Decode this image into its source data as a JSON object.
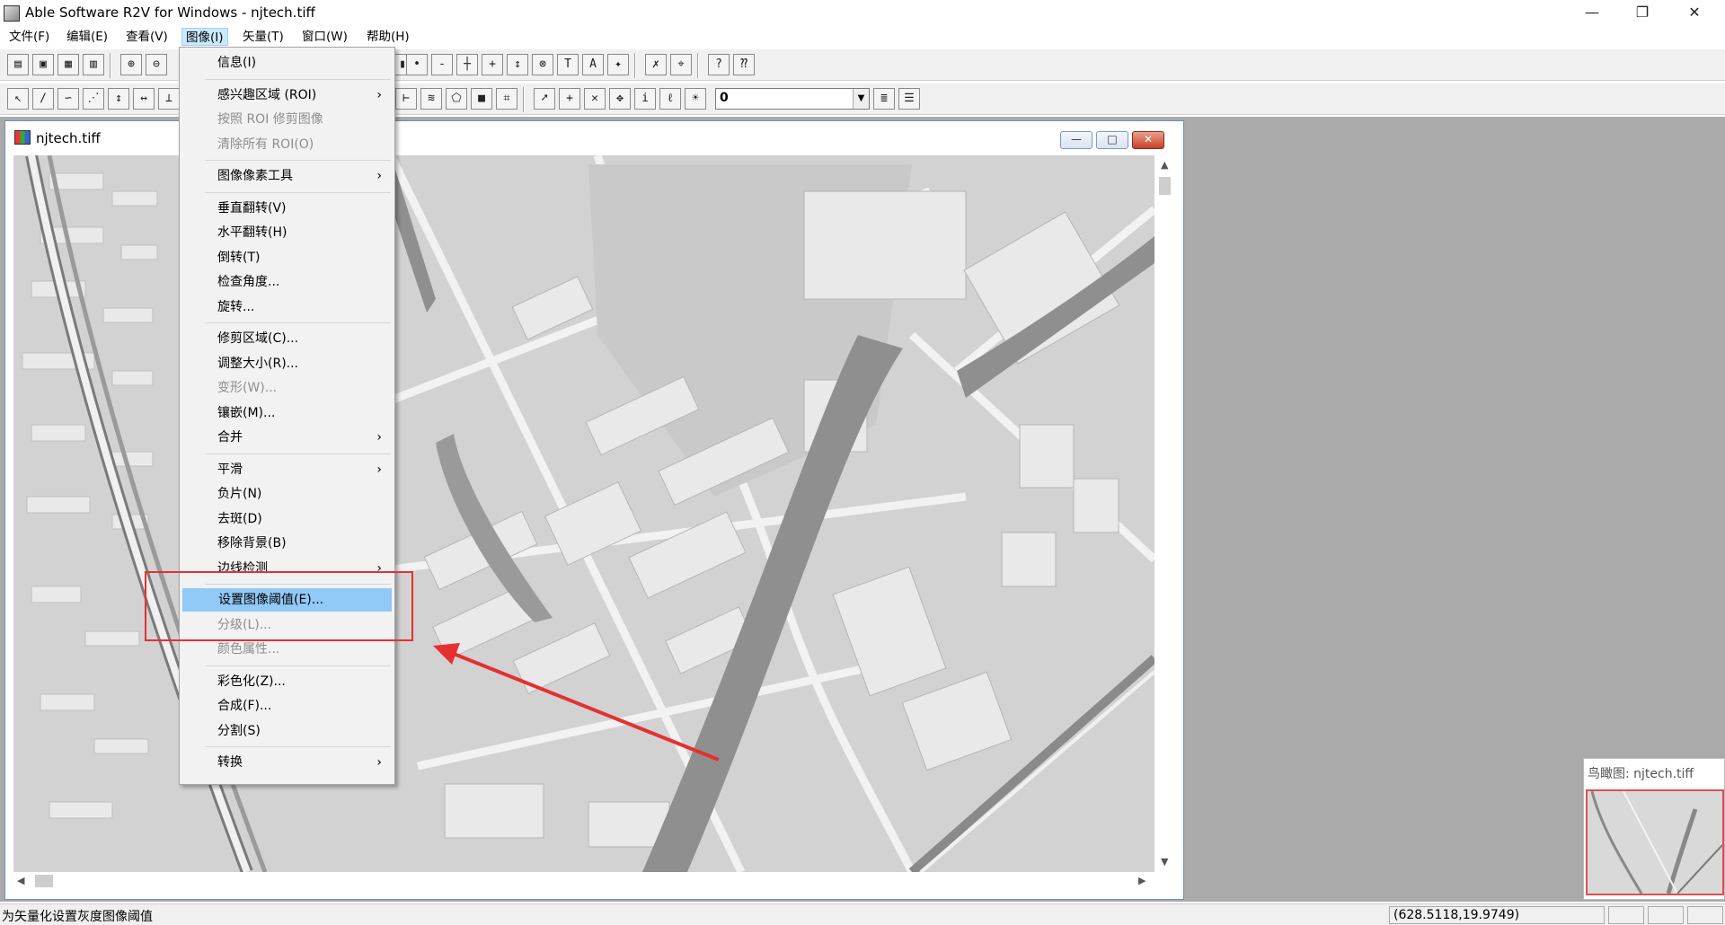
{
  "titlebar": {
    "title": "Able Software R2V for Windows - njtech.tiff",
    "minimize": "—",
    "restore": "❐",
    "close": "✕"
  },
  "menubar": [
    {
      "label": "文件(F)"
    },
    {
      "label": "编辑(E)"
    },
    {
      "label": "查看(V)"
    },
    {
      "label": "图像(I)",
      "active": true
    },
    {
      "label": "矢量(T)"
    },
    {
      "label": "窗口(W)"
    },
    {
      "label": "帮助(H)"
    }
  ],
  "toolbar": {
    "layer_value": "0"
  },
  "child_window": {
    "title": "njtech.tiff",
    "min": "—",
    "max": "□",
    "close": "✕"
  },
  "image_menu": [
    {
      "label": "信息(I)",
      "disabled": false
    },
    {
      "sep": true
    },
    {
      "label": "感兴趣区域 (ROI)",
      "submenu": true
    },
    {
      "label": "按照 ROI 修剪图像",
      "disabled": true
    },
    {
      "label": "清除所有 ROI(O)",
      "disabled": true
    },
    {
      "sep": true
    },
    {
      "label": "图像像素工具",
      "submenu": true
    },
    {
      "sep": true
    },
    {
      "label": "垂直翻转(V)"
    },
    {
      "label": "水平翻转(H)"
    },
    {
      "label": "倒转(T)"
    },
    {
      "label": "检查角度..."
    },
    {
      "label": "旋转..."
    },
    {
      "sep": true
    },
    {
      "label": "修剪区域(C)..."
    },
    {
      "label": "调整大小(R)..."
    },
    {
      "label": "变形(W)...",
      "disabled": true
    },
    {
      "label": "镶嵌(M)..."
    },
    {
      "label": "合并",
      "submenu": true
    },
    {
      "sep": true
    },
    {
      "label": "平滑",
      "submenu": true
    },
    {
      "label": "负片(N)"
    },
    {
      "label": "去斑(D)"
    },
    {
      "label": "移除背景(B)"
    },
    {
      "label": "边线检测",
      "submenu": true
    },
    {
      "sep": true
    },
    {
      "label": "设置图像阈值(E)...",
      "highlighted": true
    },
    {
      "label": "分级(L)...",
      "disabled": true
    },
    {
      "label": "颜色属性...",
      "disabled": true
    },
    {
      "sep": true
    },
    {
      "label": "彩色化(Z)..."
    },
    {
      "label": "合成(F)..."
    },
    {
      "label": "分割(S)"
    },
    {
      "sep": true
    },
    {
      "label": "转换",
      "submenu": true
    }
  ],
  "overview": {
    "title": "鸟瞰图: njtech.tiff"
  },
  "statusbar": {
    "message": "为矢量化设置灰度图像阈值",
    "coordinates": "(628.5118,19.9749)"
  },
  "colors": {
    "highlight": "#91c9f7",
    "annotation": "#e53030"
  }
}
